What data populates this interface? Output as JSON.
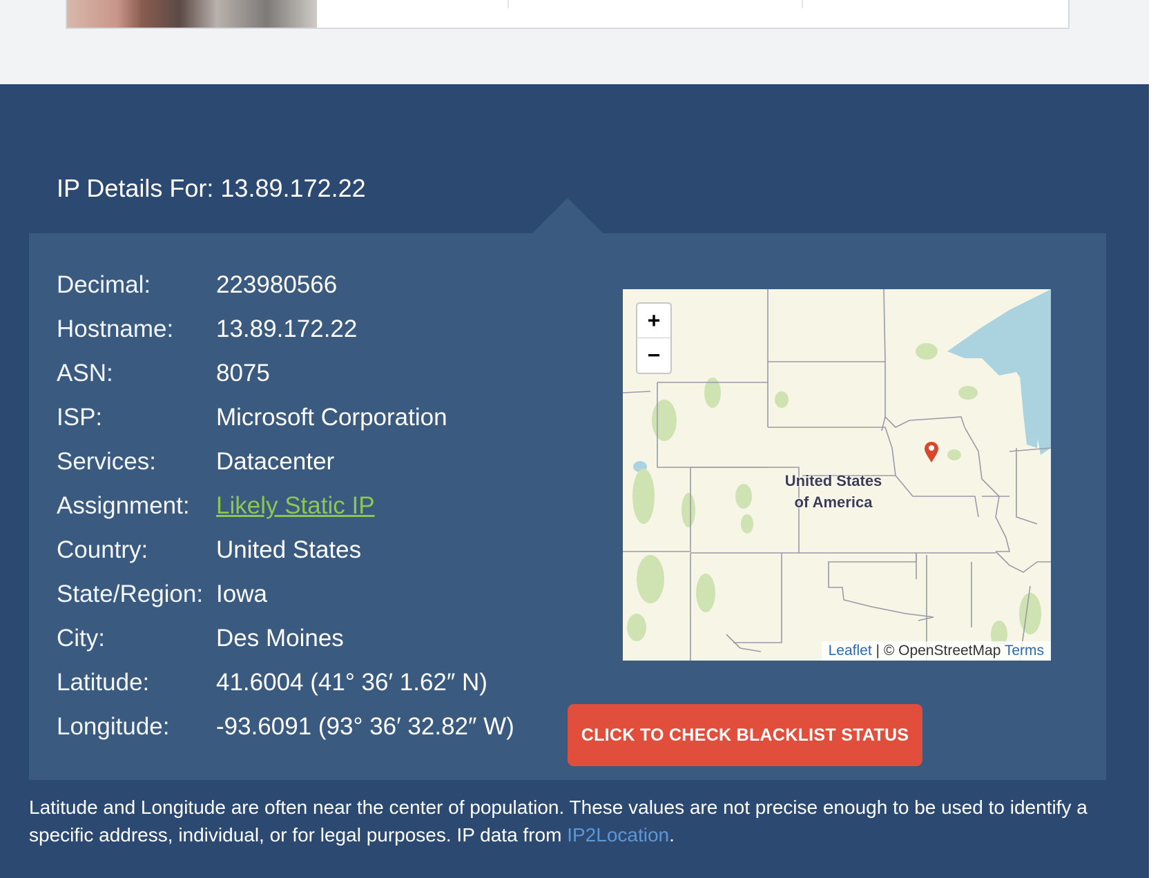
{
  "title": "IP Details For: 13.89.172.22",
  "details": [
    {
      "label": "Decimal:",
      "value": "223980566"
    },
    {
      "label": "Hostname:",
      "value": "13.89.172.22"
    },
    {
      "label": "ASN:",
      "value": "8075"
    },
    {
      "label": "ISP:",
      "value": "Microsoft Corporation"
    },
    {
      "label": "Services:",
      "value": "Datacenter"
    },
    {
      "label": "Assignment:",
      "value": "Likely Static IP"
    },
    {
      "label": "Country:",
      "value": "United States"
    },
    {
      "label": "State/Region:",
      "value": "Iowa"
    },
    {
      "label": "City:",
      "value": "Des Moines"
    },
    {
      "label": "Latitude:",
      "value": "41.6004 (41° 36′ 1.62″ N)"
    },
    {
      "label": "Longitude:",
      "value": "-93.6091 (93° 36′ 32.82″ W)"
    }
  ],
  "map": {
    "zoom_in": "+",
    "zoom_out": "−",
    "label_line1": "United States",
    "label_line2": "of America",
    "attribution_leaflet": "Leaflet",
    "attribution_sep": " | ",
    "attribution_osm": "© OpenStreetMap ",
    "attribution_terms": "Terms",
    "marker_icon": "map-pin-icon"
  },
  "blacklist_button": "CLICK TO CHECK BLACKLIST STATUS",
  "disclaimer": {
    "text": "Latitude and Longitude are often near the center of population. These values are not precise enough to be used to identify a specific address, individual, or for legal purposes. IP data from ",
    "source_link": "IP2Location",
    "end": "."
  },
  "colors": {
    "background_dark": "#2c4a71",
    "panel": "#3a5a80",
    "button": "#e24e3c",
    "link_green": "#8fc652",
    "link_blue": "#5d97d8"
  }
}
